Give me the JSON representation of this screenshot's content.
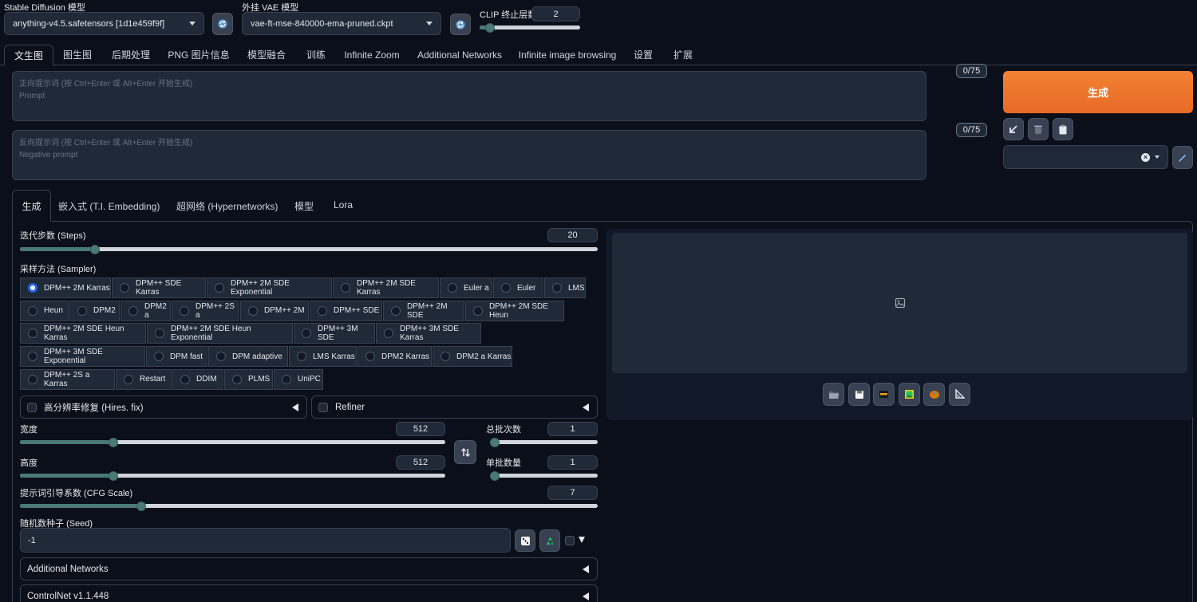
{
  "top": {
    "sd_model_label": "Stable Diffusion 模型",
    "sd_model_value": "anything-v4.5.safetensors [1d1e459f9f]",
    "vae_label": "外挂 VAE 模型",
    "vae_value": "vae-ft-mse-840000-ema-pruned.ckpt",
    "clip_label": "CLIP 终止层数",
    "clip_value": "2",
    "clip_fraction": 0.1,
    "refresh_icon": "refresh-icon"
  },
  "main_tabs": [
    "文生图",
    "图生图",
    "后期处理",
    "PNG 图片信息",
    "模型融合",
    "训练",
    "Infinite Zoom",
    "Additional Networks",
    "Infinite image browsing",
    "设置",
    "扩展"
  ],
  "prompt": {
    "placeholder_line1": "正向提示词 (按 Ctrl+Enter 或 Alt+Enter 开始生成)",
    "placeholder_line2": "Prompt",
    "token_count": "0/75"
  },
  "negative_prompt": {
    "placeholder_line1": "反向提示词 (按 Ctrl+Enter 或 Alt+Enter 开始生成)",
    "placeholder_line2": "Negative prompt",
    "token_count": "0/75"
  },
  "generate": {
    "label": "生成",
    "color": "#f0762c",
    "tool_icons": [
      "arrow-down-left-icon",
      "trash-icon",
      "clipboard-icon"
    ],
    "style_select_value": "",
    "clear_icon": "clear-x-icon",
    "edit_icon": "pencil-icon"
  },
  "sub_tabs": [
    "生成",
    "嵌入式 (T.I. Embedding)",
    "超网络 (Hypernetworks)",
    "模型",
    "Lora"
  ],
  "steps": {
    "label": "迭代步数 (Steps)",
    "value": "20",
    "fraction": 0.13
  },
  "sampler": {
    "label": "采样方法 (Sampler)",
    "selected": "DPM++ 2M Karras",
    "rows": [
      [
        "DPM++ 2M Karras",
        "DPM++ SDE Karras",
        "DPM++ 2M SDE Exponential",
        "DPM++ 2M SDE Karras",
        "Euler a",
        "Euler",
        "LMS"
      ],
      [
        "Heun",
        "DPM2",
        "DPM2 a",
        "DPM++ 2S a",
        "DPM++ 2M",
        "DPM++ SDE",
        "DPM++ 2M SDE",
        "DPM++ 2M SDE Heun"
      ],
      [
        "DPM++ 2M SDE Heun Karras",
        "DPM++ 2M SDE Heun Exponential",
        "DPM++ 3M SDE",
        "DPM++ 3M SDE Karras"
      ],
      [
        "DPM++ 3M SDE Exponential",
        "DPM fast",
        "DPM adaptive",
        "LMS Karras",
        "DPM2 Karras",
        "DPM2 a Karras"
      ],
      [
        "DPM++ 2S a Karras",
        "Restart",
        "DDIM",
        "PLMS",
        "UniPC"
      ]
    ]
  },
  "hires_fix": {
    "label": "高分辨率修复 (Hires. fix)"
  },
  "refiner": {
    "label": "Refiner"
  },
  "width": {
    "label": "宽度",
    "value": "512",
    "fraction": 0.22
  },
  "height": {
    "label": "高度",
    "value": "512",
    "fraction": 0.22
  },
  "swap_icon": "swap-arrows-icon",
  "batch_count": {
    "label": "总批次数",
    "value": "1",
    "fraction": 0.0
  },
  "batch_size": {
    "label": "单批数量",
    "value": "1",
    "fraction": 0.0
  },
  "cfg": {
    "label": "提示词引导系数 (CFG Scale)",
    "value": "7",
    "fraction": 0.21
  },
  "seed": {
    "label": "随机数种子 (Seed)",
    "value": "-1",
    "dice_icon": "dice-icon",
    "recycle_icon": "recycle-icon"
  },
  "accordions": [
    "Additional Networks",
    "ControlNet v1.1.448"
  ],
  "output": {
    "image_icon": "image-placeholder-icon",
    "tool_icons": [
      "folder-icon",
      "save-icon",
      "zip-icon",
      "send-to-img2img-icon",
      "send-to-inpaint-icon",
      "send-to-extras-icon"
    ]
  }
}
